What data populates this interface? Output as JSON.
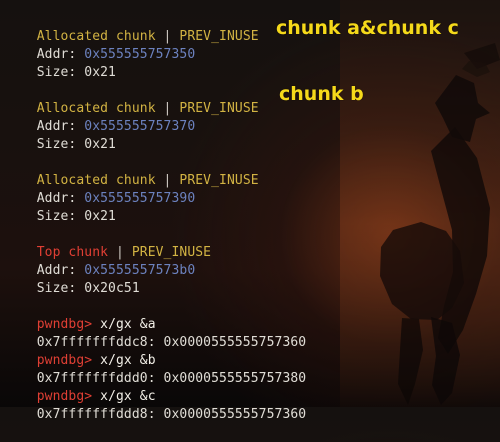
{
  "colors": {
    "allocated": "#d2b343",
    "address": "#6c82bf",
    "top_chunk": "#e03f34",
    "annotation": "#f5d91a",
    "prompt": "#e03f34"
  },
  "chunks": [
    {
      "label": "Allocated chunk",
      "separator": " | ",
      "flag": "PREV_INUSE",
      "addr_label": "Addr: ",
      "addr": "0x555555757350",
      "size_label": "Size: ",
      "size": "0x21"
    },
    {
      "label": "Allocated chunk",
      "separator": " | ",
      "flag": "PREV_INUSE",
      "addr_label": "Addr: ",
      "addr": "0x555555757370",
      "size_label": "Size: ",
      "size": "0x21"
    },
    {
      "label": "Allocated chunk",
      "separator": " | ",
      "flag": "PREV_INUSE",
      "addr_label": "Addr: ",
      "addr": "0x555555757390",
      "size_label": "Size: ",
      "size": "0x21"
    },
    {
      "label": "Top chunk",
      "separator": " | ",
      "flag": "PREV_INUSE",
      "addr_label": "Addr: ",
      "addr": "0x5555557573b0",
      "size_label": "Size: ",
      "size": "0x20c51"
    }
  ],
  "commands": [
    {
      "prompt": "pwndbg>",
      "command": " x/gx &a",
      "output": "0x7fffffffddc8: 0x0000555555757360"
    },
    {
      "prompt": "pwndbg>",
      "command": " x/gx &b",
      "output": "0x7fffffffddd0: 0x0000555555757380"
    },
    {
      "prompt": "pwndbg>",
      "command": " x/gx &c",
      "output": "0x7fffffffddd8: 0x0000555555757360"
    }
  ],
  "annotations": {
    "chunk_a_c": "chunk a&chunk c",
    "chunk_b": "chunk b"
  },
  "background": {
    "icon": "rider-silhouette-icon"
  }
}
